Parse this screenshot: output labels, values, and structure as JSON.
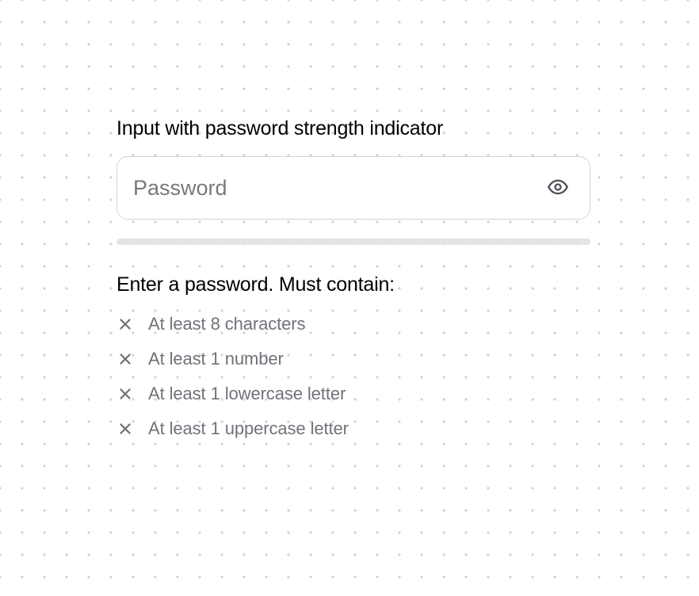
{
  "heading": "Input with password strength indicator",
  "input": {
    "placeholder": "Password",
    "value": ""
  },
  "requirements": {
    "heading": "Enter a password. Must contain:",
    "items": [
      {
        "label": "At least 8 characters",
        "met": false
      },
      {
        "label": "At least 1 number",
        "met": false
      },
      {
        "label": "At least 1 lowercase letter",
        "met": false
      },
      {
        "label": "At least 1 uppercase letter",
        "met": false
      }
    ]
  }
}
